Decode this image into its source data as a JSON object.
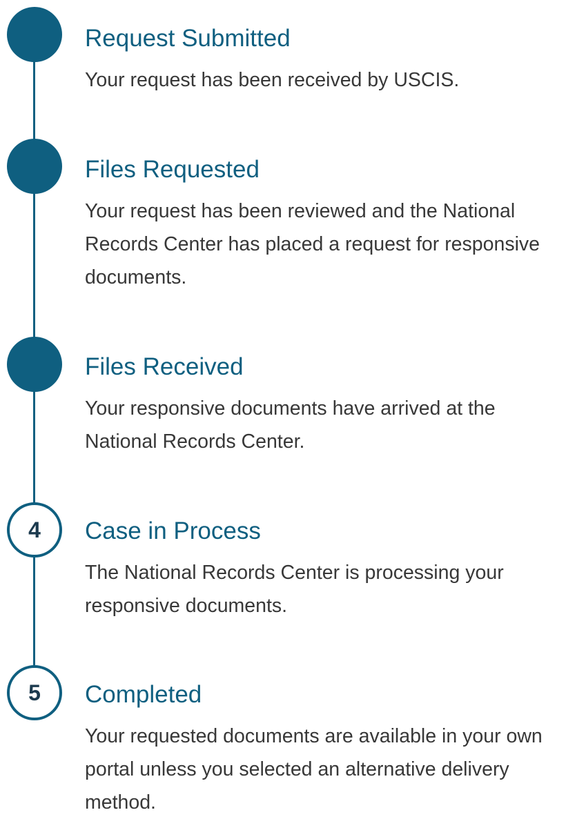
{
  "steps": [
    {
      "status": "completed",
      "number": "",
      "title": "Request Submitted",
      "description": "Your request has been received by USCIS."
    },
    {
      "status": "completed",
      "number": "",
      "title": "Files Requested",
      "description": "Your request has been reviewed and the National Records Center has placed a request for responsive documents."
    },
    {
      "status": "completed",
      "number": "",
      "title": "Files Received",
      "description": "Your responsive documents have arrived at the National Records Center."
    },
    {
      "status": "pending",
      "number": "4",
      "title": "Case in Process",
      "description": "The National Records Center is processing your responsive documents."
    },
    {
      "status": "pending",
      "number": "5",
      "title": "Completed",
      "description": "Your requested documents are available in your own portal unless you selected an alternative delivery method."
    }
  ],
  "colors": {
    "accent": "#0f5f80",
    "text": "#383838",
    "step_number": "#1c3a4e"
  }
}
